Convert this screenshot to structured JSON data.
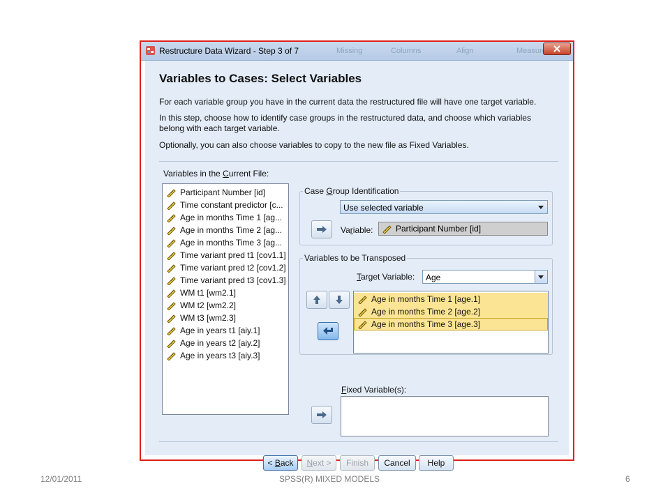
{
  "window": {
    "title": "Restructure Data Wizard - Step 3 of 7",
    "background_headers": [
      "Missing",
      "Columns",
      "Align",
      "Measure"
    ]
  },
  "page": {
    "heading": "Variables to Cases: Select Variables",
    "intro_1": "For each variable group you have in the current data the restructured file will have one target variable.",
    "intro_2a": "In this step, choose how to identify case groups in the restructured data, and choose which variables",
    "intro_2b": "belong with each target variable.",
    "intro_3": "Optionally, you can also choose variables to copy to the new file as Fixed Variables."
  },
  "source": {
    "label_pre": "Variables in the ",
    "label_key": "C",
    "label_post": "urrent File:",
    "items": [
      "Participant Number [id]",
      "Time constant predictor [c...",
      "Age in months Time 1 [ag...",
      "Age in months Time 2 [ag...",
      "Age in months Time 3 [ag...",
      "Time variant pred t1 [cov1.1]",
      "Time variant pred t2 [cov1.2]",
      "Time variant pred t3 [cov1.3]",
      "WM t1 [wm2.1]",
      "WM t2 [wm2.2]",
      "WM t3 [wm2.3]",
      "Age in years t1 [aiy.1]",
      "Age in years t2 [aiy.2]",
      "Age in years t3 [aiy.3]"
    ]
  },
  "case_group": {
    "title_pre": "Case ",
    "title_key": "G",
    "title_post": "roup Identification",
    "method": "Use selected variable",
    "variable_label_pre": "Va",
    "variable_label_key": "r",
    "variable_label_post": "iable:",
    "variable_value": "Participant Number [id]"
  },
  "transposed": {
    "title": "Variables to be Transposed",
    "target_label_key": "T",
    "target_label_post": "arget Variable:",
    "target_value": "Age",
    "items": [
      "Age in months Time 1 [age.1]",
      "Age in months Time 2 [age.2]",
      "Age in months Time 3 [age.3]"
    ]
  },
  "fixed": {
    "label_key": "F",
    "label_post": "ixed Variable(s):"
  },
  "buttons": {
    "back_pre": "< ",
    "back_key": "B",
    "back_post": "ack",
    "next_key": "N",
    "next_post": "ext >",
    "finish": "Finish",
    "cancel": "Cancel",
    "help": "Help"
  },
  "slide_footer": {
    "date": "12/01/2011",
    "title": "SPSS(R) MIXED MODELS",
    "page": "6"
  },
  "colors": {
    "frame_border": "#e0201c",
    "dialog_bg": "#e3ecf7",
    "selection": "#fbe494"
  }
}
